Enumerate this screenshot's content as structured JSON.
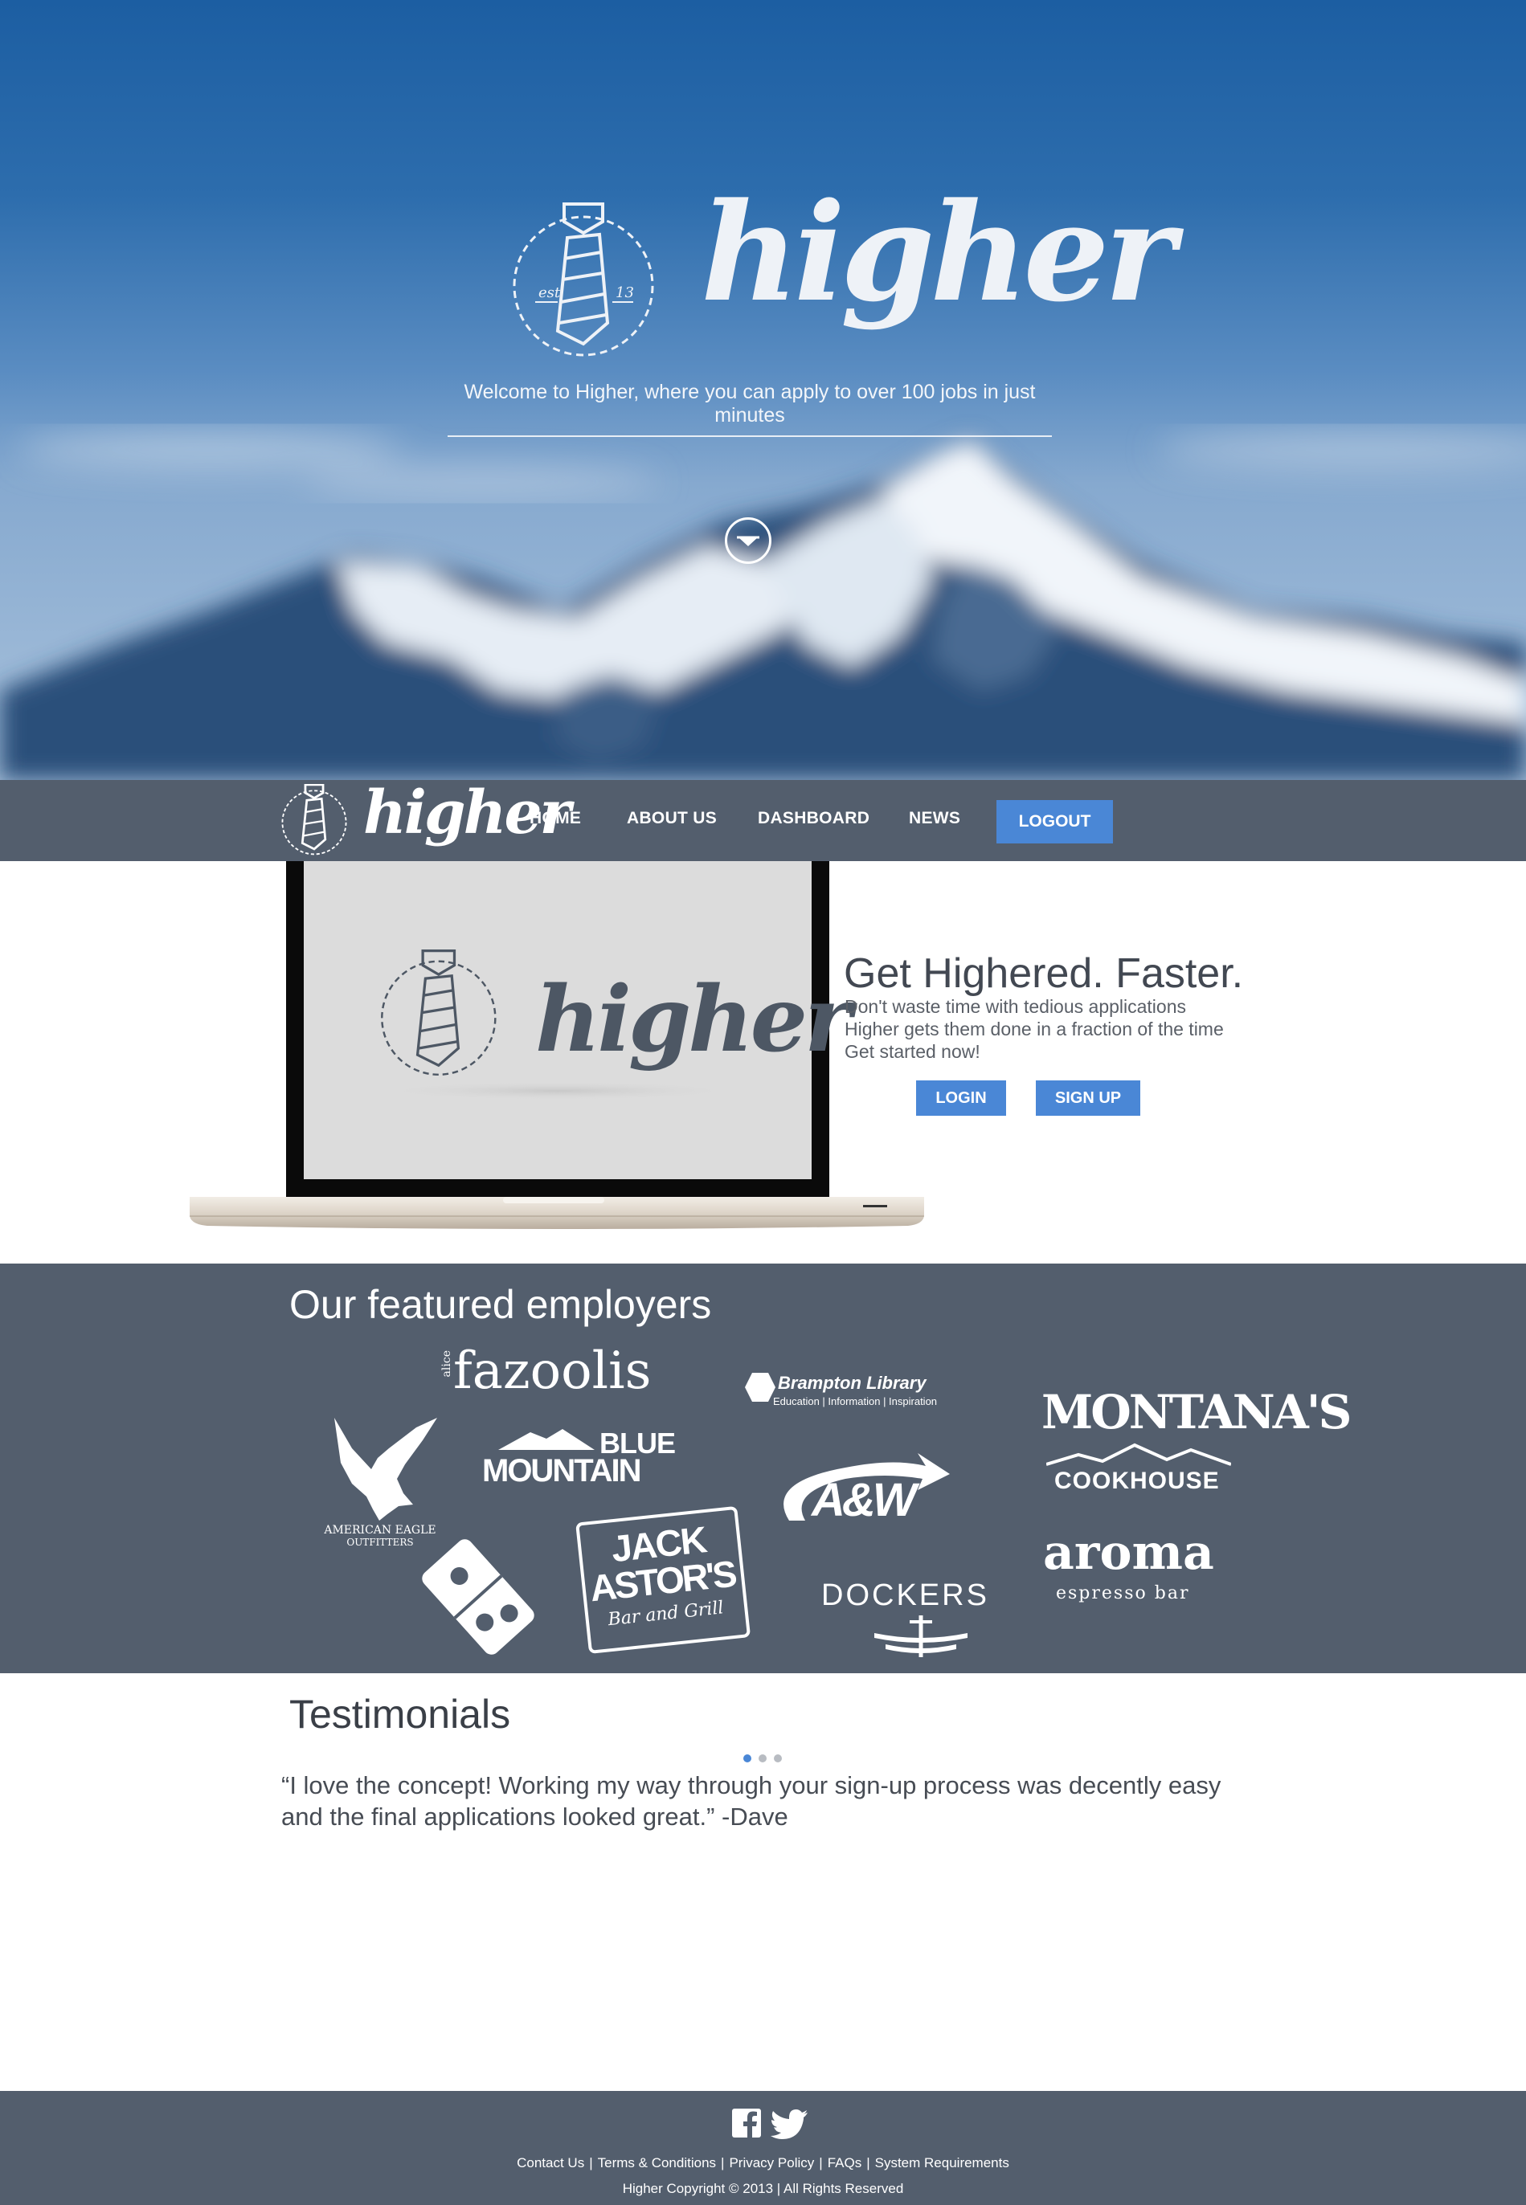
{
  "colors": {
    "accent": "#4a87d6",
    "nav_bg": "#535e6d",
    "sky_top": "#1c5ea2",
    "inactive_dot": "#b8bcc2"
  },
  "hero": {
    "brand": "higher",
    "emblem": {
      "left_text": "est",
      "right_text": "13"
    },
    "tagline": "Welcome to Higher, where you can apply to over 100 jobs in just minutes",
    "scroll_icon": "chevron-down-circle-icon"
  },
  "nav": {
    "brand": "higher",
    "items": [
      {
        "label": "HOME"
      },
      {
        "label": "ABOUT US"
      },
      {
        "label": "DASHBOARD"
      },
      {
        "label": "NEWS"
      }
    ],
    "logout_label": "LOGOUT"
  },
  "promo": {
    "screen_brand": "higher",
    "title": "Get Highered. Faster.",
    "lines": [
      "Don't waste time with tedious applications",
      "Higher gets them done in a fraction of the time",
      "Get started now!"
    ],
    "login_label": "LOGIN",
    "signup_label": "SIGN UP"
  },
  "employers": {
    "title": "Our featured employers",
    "logos": {
      "fazolis_small": "alice",
      "fazolis": "fazoolis",
      "brampton_title": "Brampton Library",
      "brampton_sub": "Education | Information | Inspiration",
      "montanas": "MONTANA'S",
      "montanas_sub": "COOKHOUSE",
      "ae_line1": "AMERICAN EAGLE",
      "ae_line2": "OUTFITTERS",
      "blue_mountain_1": "BLUE",
      "blue_mountain_2": "MOUNTAIN",
      "aw": "A&W",
      "jack_astors_1": "JACK",
      "jack_astors_2": "ASTOR'S",
      "jack_astors_3": "Bar and Grill",
      "dockers": "DOCKERS",
      "aroma": "aroma",
      "aroma_sub": "espresso bar"
    }
  },
  "testimonials": {
    "title": "Testimonials",
    "active_index": 0,
    "quote_line1": "“I love the concept! Working my way through your sign-up process was decently easy",
    "quote_line2": "and the final applications looked great.” -Dave"
  },
  "footer": {
    "social": [
      "facebook-icon",
      "twitter-icon"
    ],
    "links": [
      "Contact Us",
      "Terms & Conditions",
      "Privacy Policy",
      "FAQs",
      "System Requirements"
    ],
    "copyright": "Higher Copyright © 2013 | All Rights Reserved"
  }
}
